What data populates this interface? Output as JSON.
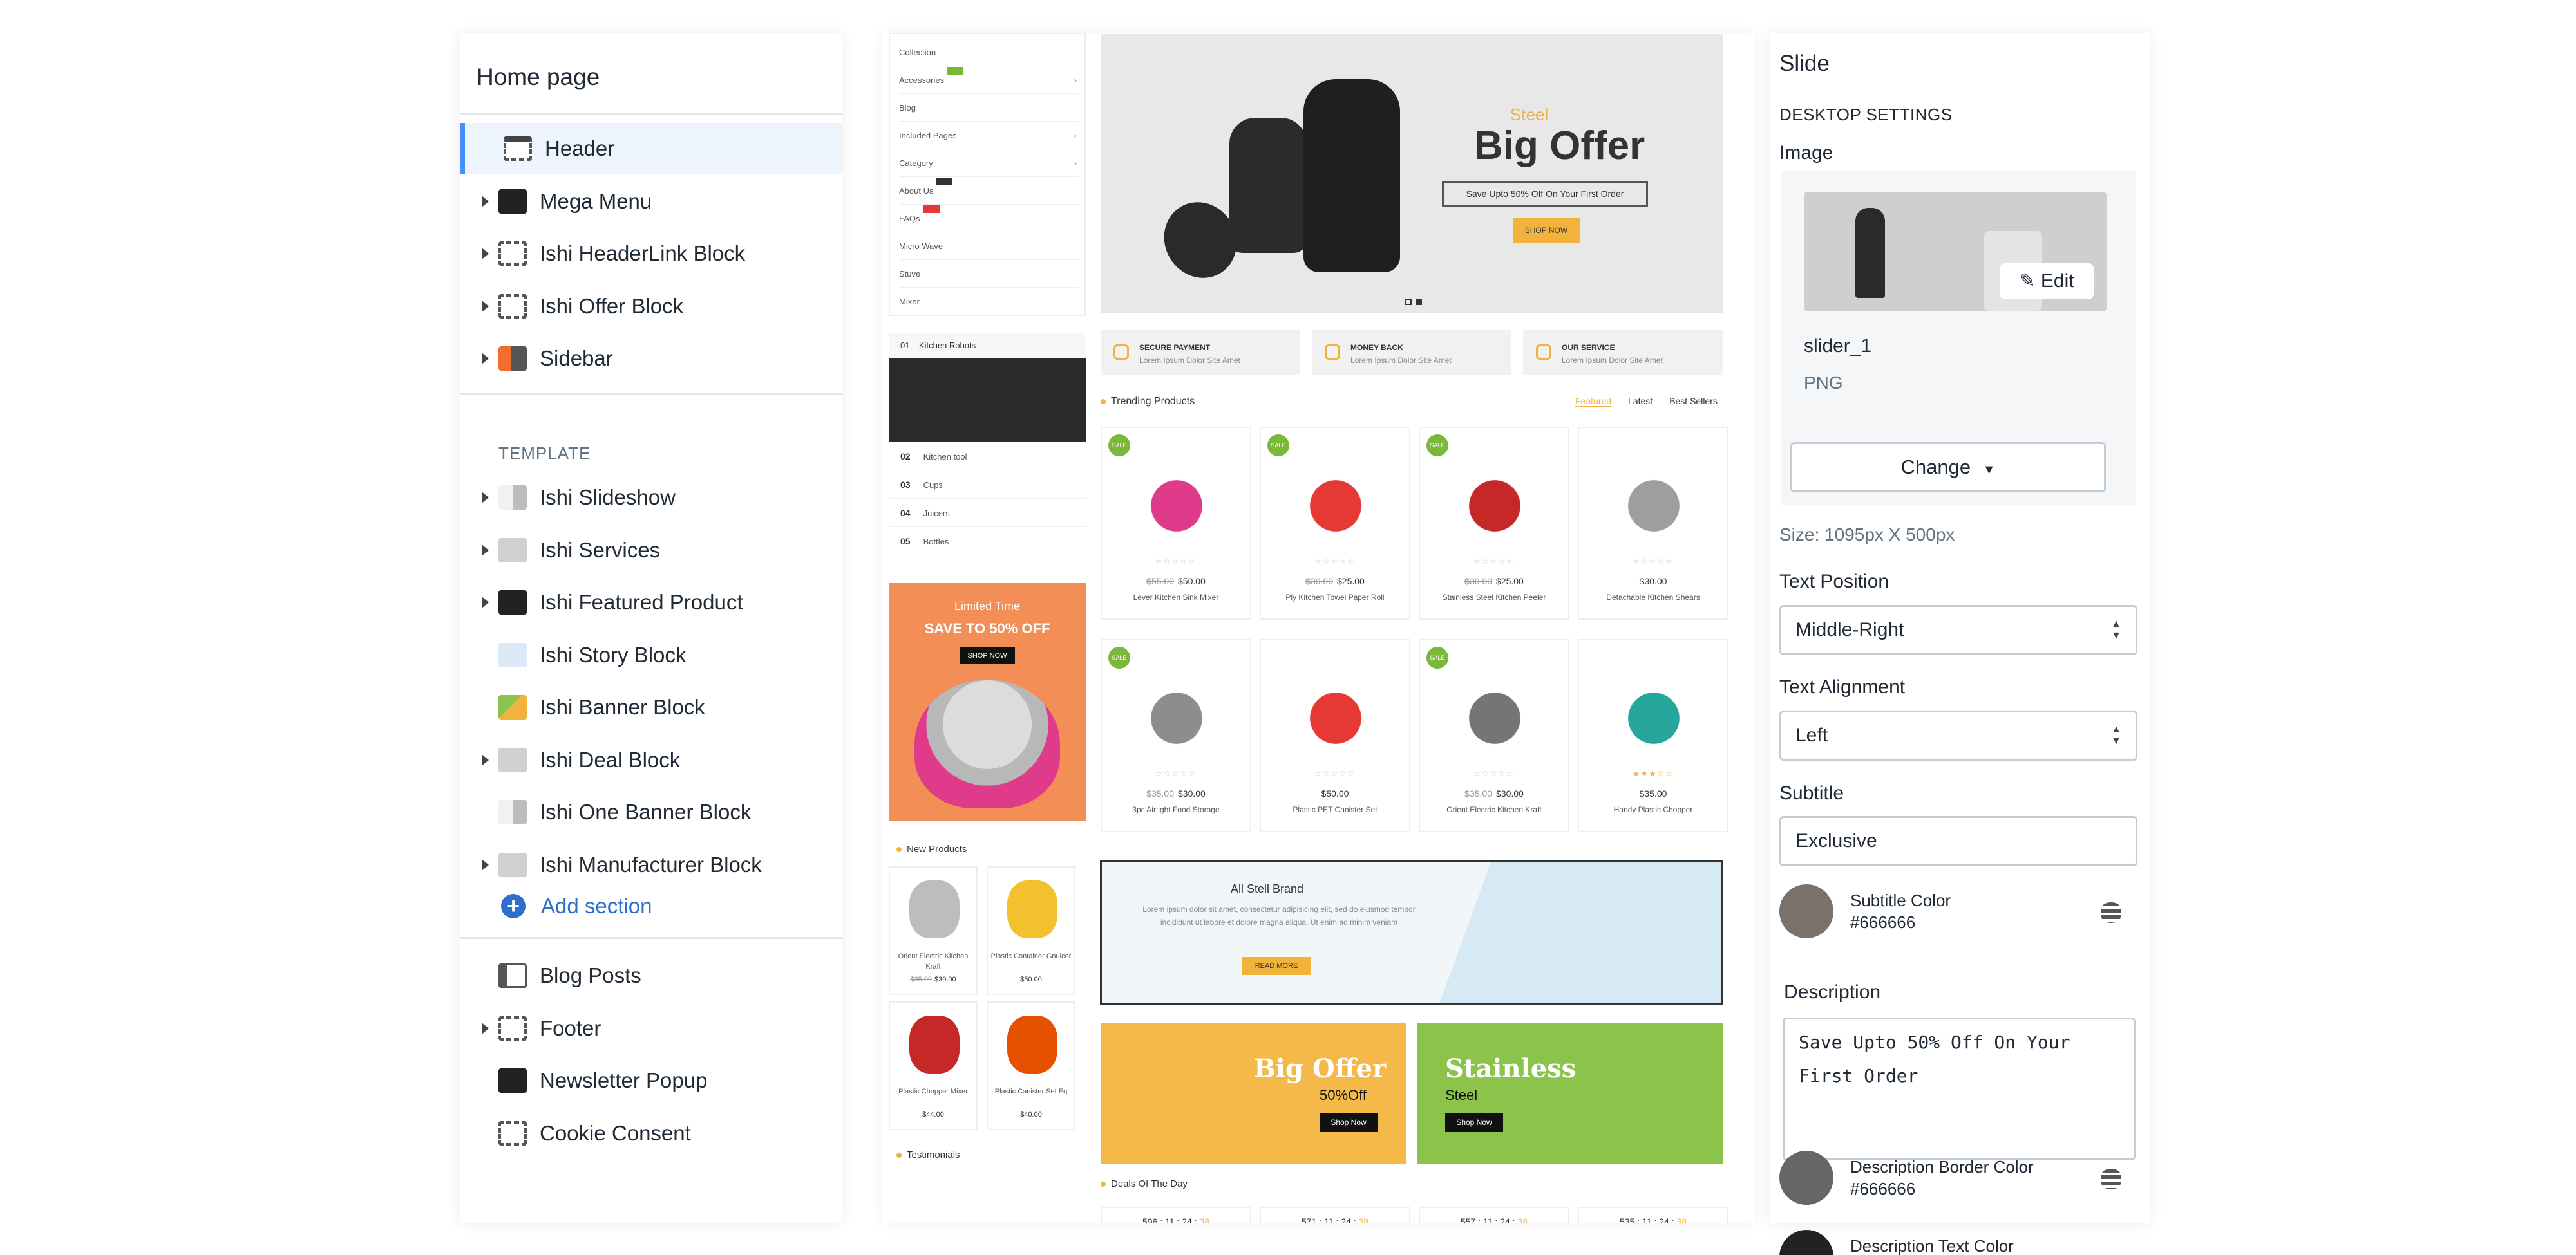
{
  "sidebar": {
    "title": "Home page",
    "items": [
      {
        "label": "Header",
        "icon": "header-layout-icon",
        "expandable": false,
        "active": true
      },
      {
        "label": "Mega Menu",
        "icon": "mega-menu-icon",
        "expandable": true
      },
      {
        "label": "Ishi HeaderLink Block",
        "icon": "header-link-icon",
        "expandable": true
      },
      {
        "label": "Ishi Offer Block",
        "icon": "offer-block-icon",
        "expandable": true
      },
      {
        "label": "Sidebar",
        "icon": "sidebar-icon",
        "expandable": true
      }
    ],
    "template_label": "TEMPLATE",
    "template_items": [
      {
        "label": "Ishi Slideshow",
        "icon": "slideshow-icon",
        "expandable": true
      },
      {
        "label": "Ishi Services",
        "icon": "services-icon",
        "expandable": true
      },
      {
        "label": "Ishi Featured Product",
        "icon": "featured-product-icon",
        "expandable": true
      },
      {
        "label": "Ishi Story Block",
        "icon": "story-block-icon",
        "expandable": false
      },
      {
        "label": "Ishi Banner Block",
        "icon": "banner-block-icon",
        "expandable": false
      },
      {
        "label": "Ishi Deal Block",
        "icon": "deal-block-icon",
        "expandable": true
      },
      {
        "label": "Ishi One Banner Block",
        "icon": "one-banner-icon",
        "expandable": false
      },
      {
        "label": "Ishi Manufacturer Block",
        "icon": "manufacturer-icon",
        "expandable": true
      }
    ],
    "add_section": "Add section",
    "footer_items": [
      {
        "label": "Blog Posts",
        "icon": "blog-posts-icon",
        "expandable": false
      },
      {
        "label": "Footer",
        "icon": "footer-layout-icon",
        "expandable": true
      },
      {
        "label": "Newsletter Popup",
        "icon": "newsletter-icon",
        "expandable": false
      },
      {
        "label": "Cookie Consent",
        "icon": "cookie-icon",
        "expandable": false
      }
    ]
  },
  "preview": {
    "menu": [
      {
        "label": "Collection"
      },
      {
        "label": "Accessories",
        "chevron": true,
        "tag_color": "#7ab839"
      },
      {
        "label": "Blog"
      },
      {
        "label": "Included Pages",
        "chevron": true
      },
      {
        "label": "Category",
        "chevron": true
      },
      {
        "label": "About Us",
        "tag_color": "#333333"
      },
      {
        "label": "FAQs",
        "tag_color": "#e53935"
      },
      {
        "label": "Micro Wave"
      },
      {
        "label": "Stuve"
      },
      {
        "label": "Mixer"
      }
    ],
    "hero": {
      "subtitle": "Steel",
      "headline": "Big Offer",
      "description": "Save Upto 50% Off On Your First Order",
      "button": "SHOP NOW"
    },
    "services": [
      {
        "title": "SECURE PAYMENT",
        "text": "Lorem Ipsum Dolor Site Amet"
      },
      {
        "title": "MONEY BACK",
        "text": "Lorem Ipsum Dolor Site Amet"
      },
      {
        "title": "OUR SERVICE",
        "text": "Lorem Ipsum Dolor Site Amet"
      }
    ],
    "trending_title": "Trending Products",
    "tabs": [
      "Featured",
      "Latest",
      "Best Sellers"
    ],
    "sale_badge": "SALE",
    "products": [
      {
        "name": "Lever Kitchen Sink Mixer",
        "old": "$55.00",
        "price": "$50.00",
        "sale": true,
        "rating": 0,
        "color": "#e03b8b"
      },
      {
        "name": "Ply Kitchen Towel Paper Roll",
        "old": "$30.00",
        "price": "$25.00",
        "sale": true,
        "rating": 0,
        "color": "#e53935"
      },
      {
        "name": "Stainless Steel Kitchen Peeler",
        "old": "$30.00",
        "price": "$25.00",
        "sale": true,
        "rating": 0,
        "color": "#c62828"
      },
      {
        "name": "Detachable Kitchen Shears",
        "old": "",
        "price": "$30.00",
        "sale": false,
        "rating": 0,
        "color": "#9e9e9e"
      },
      {
        "name": "3pc Airtight Food Storage",
        "old": "$35.00",
        "price": "$30.00",
        "sale": true,
        "rating": 0,
        "color": "#8d8d8d"
      },
      {
        "name": "Plastic PET Canister Set",
        "old": "",
        "price": "$50.00",
        "sale": false,
        "rating": 0,
        "color": "#e53935"
      },
      {
        "name": "Orient Electric Kitchen Kraft",
        "old": "$35.00",
        "price": "$30.00",
        "sale": true,
        "rating": 0,
        "color": "#757575"
      },
      {
        "name": "Handy Plastic Chopper",
        "old": "",
        "price": "$35.00",
        "sale": false,
        "rating": 3,
        "color": "#26a69a"
      }
    ],
    "left_list": {
      "first_num": "01",
      "first_label": "Kitchen Robots",
      "items": [
        {
          "num": "02",
          "label": "Kitchen tool"
        },
        {
          "num": "03",
          "label": "Cups"
        },
        {
          "num": "04",
          "label": "Juicers"
        },
        {
          "num": "05",
          "label": "Bottles"
        }
      ]
    },
    "limited": {
      "line1": "Limited Time",
      "line2": "SAVE TO 50% OFF",
      "button": "SHOP NOW"
    },
    "new_products_title": "New Products",
    "new_products": [
      {
        "name": "Orient Electric Kitchen Kraft",
        "old": "$35.00",
        "price": "$30.00",
        "color": "#bdbdbd"
      },
      {
        "name": "Plastic Container Gnulcer",
        "old": "",
        "price": "$50.00",
        "color": "#f2c12e"
      },
      {
        "name": "Plastic Chopper Mixer",
        "old": "",
        "price": "$44.00",
        "color": "#c62828"
      },
      {
        "name": "Plastic Canister Set Eq",
        "old": "",
        "price": "$40.00",
        "color": "#e65100"
      }
    ],
    "testimonials_title": "Testimonials",
    "brand_banner": {
      "title": "All Stell Brand",
      "text": "Lorem ipsum dolor sit amet, consectetur adipisicing elit, sed do eiusmod tempor incididunt ut labore et dolore magna aliqua. Ut enim ad minim veniam",
      "button": "READ MORE"
    },
    "promo1": {
      "title": "Big Offer",
      "sub": "50%Off",
      "button": "Shop Now",
      "bg": "#f5b94a"
    },
    "promo2": {
      "title": "Stainless",
      "sub": "Steel",
      "button": "Shop Now",
      "bg": "#8cc34a"
    },
    "deals_title": "Deals Of The Day",
    "deals": [
      {
        "d": "596",
        "h": "11",
        "m": "24",
        "s": "38"
      },
      {
        "d": "571",
        "h": "11",
        "m": "24",
        "s": "38"
      },
      {
        "d": "557",
        "h": "11",
        "m": "24",
        "s": "38"
      },
      {
        "d": "535",
        "h": "11",
        "m": "24",
        "s": "38"
      }
    ]
  },
  "settings": {
    "title": "Slide",
    "desktop_heading": "DESKTOP SETTINGS",
    "image_label": "Image",
    "edit_label": "Edit",
    "file_name": "slider_1",
    "file_type": "PNG",
    "change_label": "Change",
    "size_note": "Size: 1095px X 500px",
    "text_position_label": "Text Position",
    "text_position_value": "Middle-Right",
    "text_alignment_label": "Text Alignment",
    "text_alignment_value": "Left",
    "subtitle_label": "Subtitle",
    "subtitle_value": "Exclusive",
    "subtitle_color_label": "Subtitle Color",
    "subtitle_color_value": "#666666",
    "description_label": "Description",
    "description_value": "Save Upto 50% Off On Your First Order",
    "desc_border_color_label": "Description Border Color",
    "desc_border_color_value": "#666666",
    "desc_text_color_label": "Description Text Color",
    "colors": {
      "subtitle": "#7a7168",
      "desc_border": "#666666",
      "desc_text": "#222222",
      "accent": "#2c6ecb"
    }
  }
}
